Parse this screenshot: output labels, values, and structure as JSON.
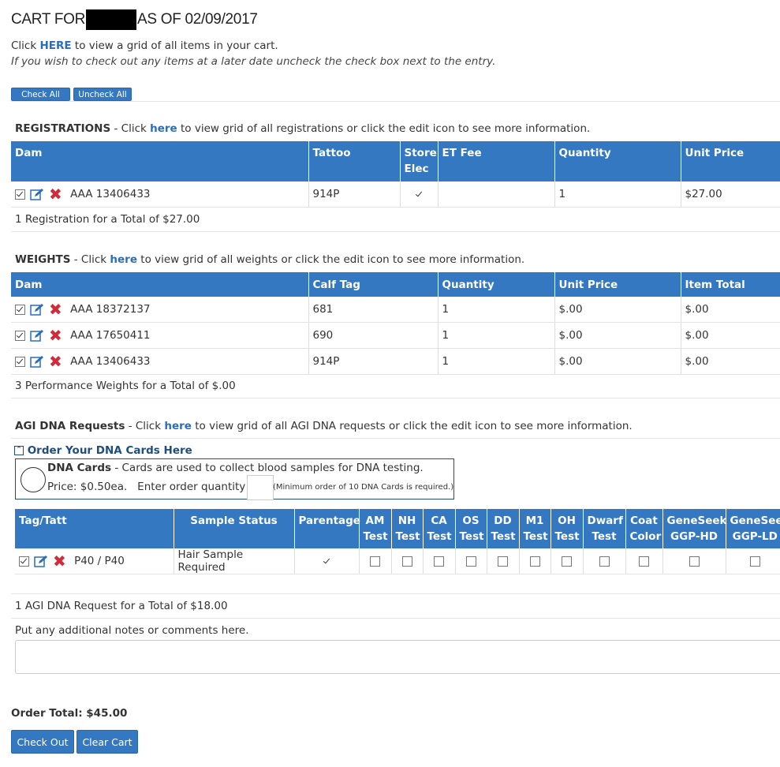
{
  "header": {
    "title_prefix": "CART FOR",
    "title_suffix": "AS OF 02/09/2017",
    "line1_pre": "Click",
    "line1_link": "HERE",
    "line1_post": "to view a grid of all items in your cart.",
    "line2": "If you wish to check out any items at a later date uncheck the check box next to the entry."
  },
  "buttons": {
    "check_all": "Check All",
    "uncheck_all": "Uncheck All",
    "check_out": "Check Out",
    "clear_cart": "Clear Cart"
  },
  "registrations": {
    "title": "REGISTRATIONS",
    "desc_pre": "- Click",
    "link": "here",
    "desc_post": "to view grid of all registrations or click the edit icon to see more information.",
    "columns": [
      "Dam",
      "Tattoo",
      "Store Elec",
      "ET Fee",
      "Quantity",
      "Unit Price"
    ],
    "rows": [
      {
        "dam": "AAA 13406433",
        "tattoo": "914P",
        "store_elec": true,
        "et_fee": "",
        "quantity": "1",
        "unit_price": "$27.00"
      }
    ],
    "total": "1 Registration for a Total of $27.00"
  },
  "weights": {
    "title": "WEIGHTS",
    "desc_pre": "- Click",
    "link": "here",
    "desc_post": "to view grid of all weights or click the edit icon to see more information.",
    "columns": [
      "Dam",
      "Calf Tag",
      "Quantity",
      "Unit Price",
      "Item Total"
    ],
    "rows": [
      {
        "dam": "AAA 18372137",
        "calf_tag": "681",
        "quantity": "1",
        "unit_price": "$.00",
        "item_total": "$.00"
      },
      {
        "dam": "AAA 17650411",
        "calf_tag": "690",
        "quantity": "1",
        "unit_price": "$.00",
        "item_total": "$.00"
      },
      {
        "dam": "AAA 13406433",
        "calf_tag": "914P",
        "quantity": "1",
        "unit_price": "$.00",
        "item_total": "$.00"
      }
    ],
    "total": "3 Performance Weights for a Total of $.00"
  },
  "dna": {
    "title": "AGI DNA Requests",
    "desc_pre": "- Click",
    "link": "here",
    "desc_post": "to view grid of all AGI DNA requests or click the edit icon to see more information.",
    "order_link": "Order Your DNA Cards Here",
    "card_title": "DNA Cards",
    "card_desc": "- Cards are used to collect blood samples for DNA testing.",
    "price_text": "Price: $0.50ea.",
    "enter_qty": "Enter order quantity :",
    "min_note": "(Minimum order of 10 DNA Cards is required.)",
    "columns": [
      "Tag/Tatt",
      "Sample Status",
      "Parentage",
      "AM Test",
      "NH Test",
      "CA Test",
      "OS Test",
      "DD Test",
      "M1 Test",
      "OH Test",
      "Dwarf Test",
      "Coat Color",
      "GeneSeek GGP-HD",
      "GeneSeek GGP-LD"
    ],
    "row": {
      "tag": "P40 / P40",
      "status": "Hair Sample Required"
    },
    "total": "1 AGI DNA Request for a Total of $18.00",
    "notes_label": "Put any additional notes or comments here."
  },
  "order_total": "Order Total: $45.00",
  "icons": {
    "edit": "edit-icon",
    "delete": "delete-icon",
    "collapse": "collapse-up-icon",
    "circle": "dna-card-icon"
  },
  "colors": {
    "header_blue": "#3478c1",
    "link_blue": "#2a6ebb",
    "delete_red": "#d12b3a"
  }
}
